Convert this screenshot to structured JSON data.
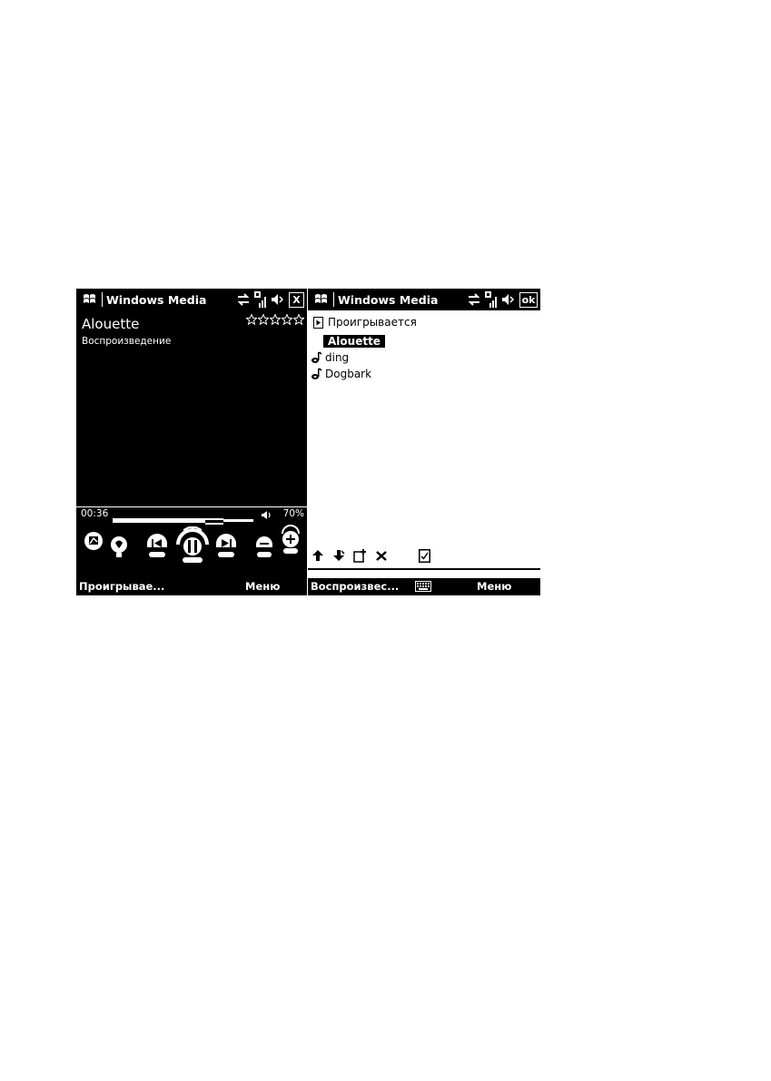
{
  "left_screen": {
    "titlebar": {
      "title": "Windows Media",
      "close_label": "X"
    },
    "now_playing": {
      "track_title": "Alouette",
      "status": "Воспроизведение",
      "rating_stars": 5
    },
    "seek": {
      "elapsed": "00:36",
      "progress_fraction": 0.72
    },
    "volume": {
      "level_text": "70%"
    },
    "controls": [
      "equalizer-icon",
      "bulb-icon",
      "previous-icon",
      "pause-icon",
      "next-icon",
      "volume-down-icon",
      "volume-up-icon"
    ],
    "softkeys": {
      "left": "Проигрывае...",
      "right": "Меню"
    }
  },
  "right_screen": {
    "titlebar": {
      "title": "Windows Media",
      "ok_label": "ok"
    },
    "playlist": {
      "header": "Проигрывается",
      "items": [
        {
          "name": "Alouette",
          "selected": true
        },
        {
          "name": "ding",
          "selected": false
        },
        {
          "name": "Dogbark",
          "selected": false
        }
      ]
    },
    "toolbar": [
      "move-up-icon",
      "move-down-icon",
      "add-item-icon",
      "delete-icon",
      "properties-icon"
    ],
    "softkeys": {
      "left": "Воспроизвес...",
      "right": "Меню"
    }
  },
  "colors": {
    "background": "#ffffff",
    "screen_dark": "#000000",
    "text_light": "#ffffff"
  }
}
